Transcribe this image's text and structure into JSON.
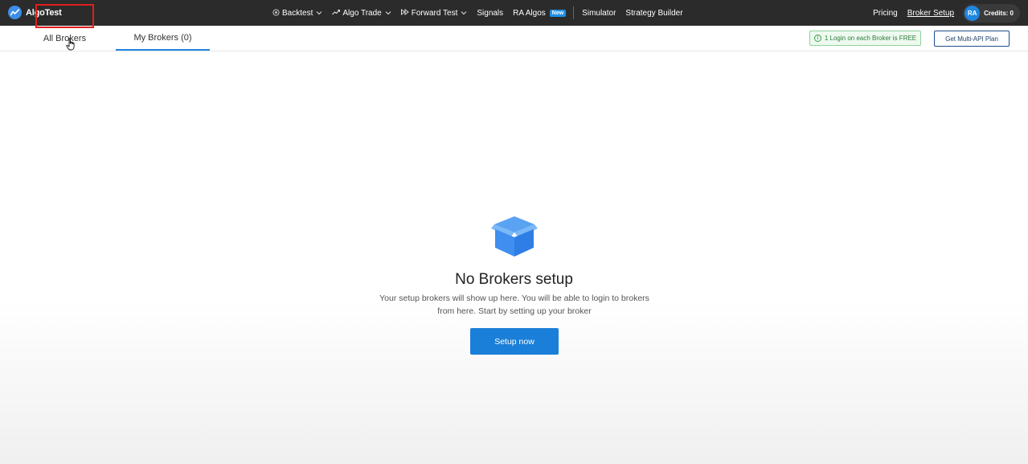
{
  "app": {
    "logo_text": "AlgoTest"
  },
  "nav": {
    "items": [
      {
        "label": "Backtest",
        "icon": "target-icon",
        "has_dropdown": true
      },
      {
        "label": "Algo Trade",
        "icon": "trend-up-icon",
        "has_dropdown": true
      },
      {
        "label": "Forward Test",
        "icon": "fast-forward-icon",
        "has_dropdown": true
      },
      {
        "label": "Signals"
      },
      {
        "label": "RA Algos",
        "badge": "New"
      },
      {
        "label": "Simulator"
      },
      {
        "label": "Strategy Builder"
      }
    ],
    "right": {
      "pricing": "Pricing",
      "broker_setup": "Broker Setup",
      "avatar_initials": "RA",
      "credits": "Credits: 0"
    }
  },
  "subbar": {
    "tabs": [
      {
        "label": "All Brokers"
      },
      {
        "label": "My Brokers (0)"
      }
    ],
    "free_note": "1 Login on each Broker is FREE",
    "multi_api_button": "Get Multi-API Plan"
  },
  "empty_state": {
    "icon": "box-icon",
    "title": "No Brokers setup",
    "description_line1": "Your setup brokers will show up here. You will be able to login to brokers",
    "description_line2": "from here. Start by setting up your broker",
    "button": "Setup now"
  },
  "colors": {
    "topbar_bg": "#2b2b2b",
    "accent": "#1a7fd8",
    "highlight": "#e01e1e"
  }
}
